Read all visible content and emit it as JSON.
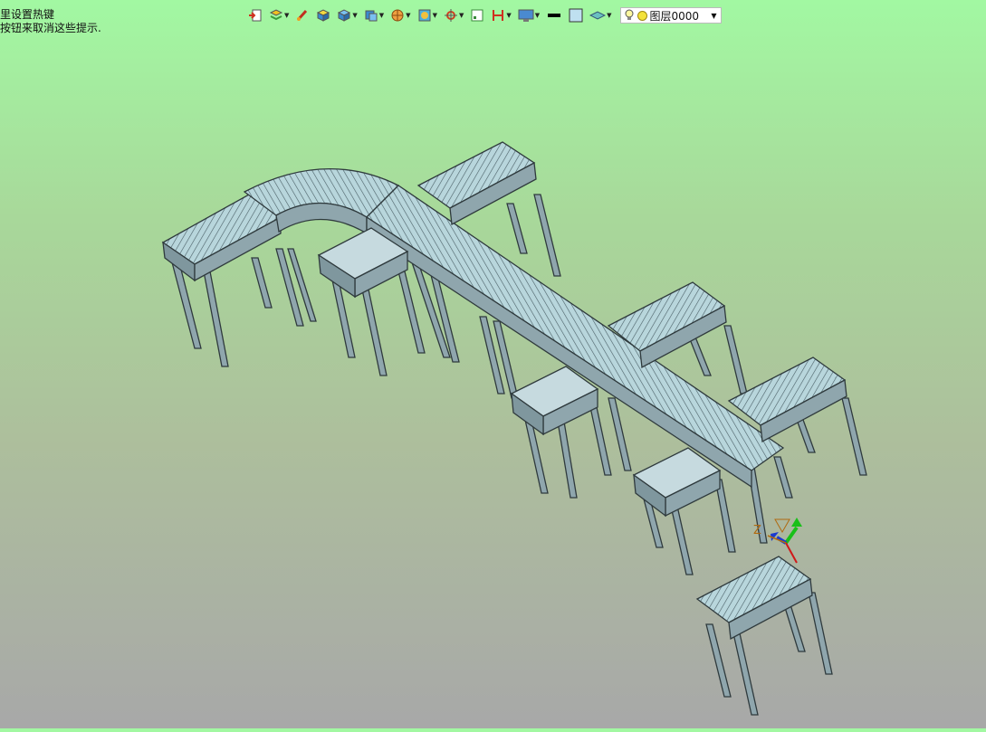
{
  "hints": {
    "line1": "里设置热键",
    "line2": "按钮来取消这些提示."
  },
  "toolbar": {
    "layer_name": "图层0000",
    "buttons": [
      "import-icon",
      "layers-icon",
      "brush-icon",
      "box-yellow-icon",
      "box-blue-icon",
      "cube-view-icon",
      "sphere-icon",
      "shade-icon",
      "snap-icon",
      "frame-icon",
      "measure-icon",
      "display-icon",
      "line-color-icon",
      "fill-color-icon",
      "material-icon"
    ]
  },
  "viewport": {
    "background_top": "#a2f8a2",
    "background_bottom": "#a8a8a8",
    "model_color": "#9fb8c0",
    "axis_labels": {
      "z": "Z"
    }
  }
}
